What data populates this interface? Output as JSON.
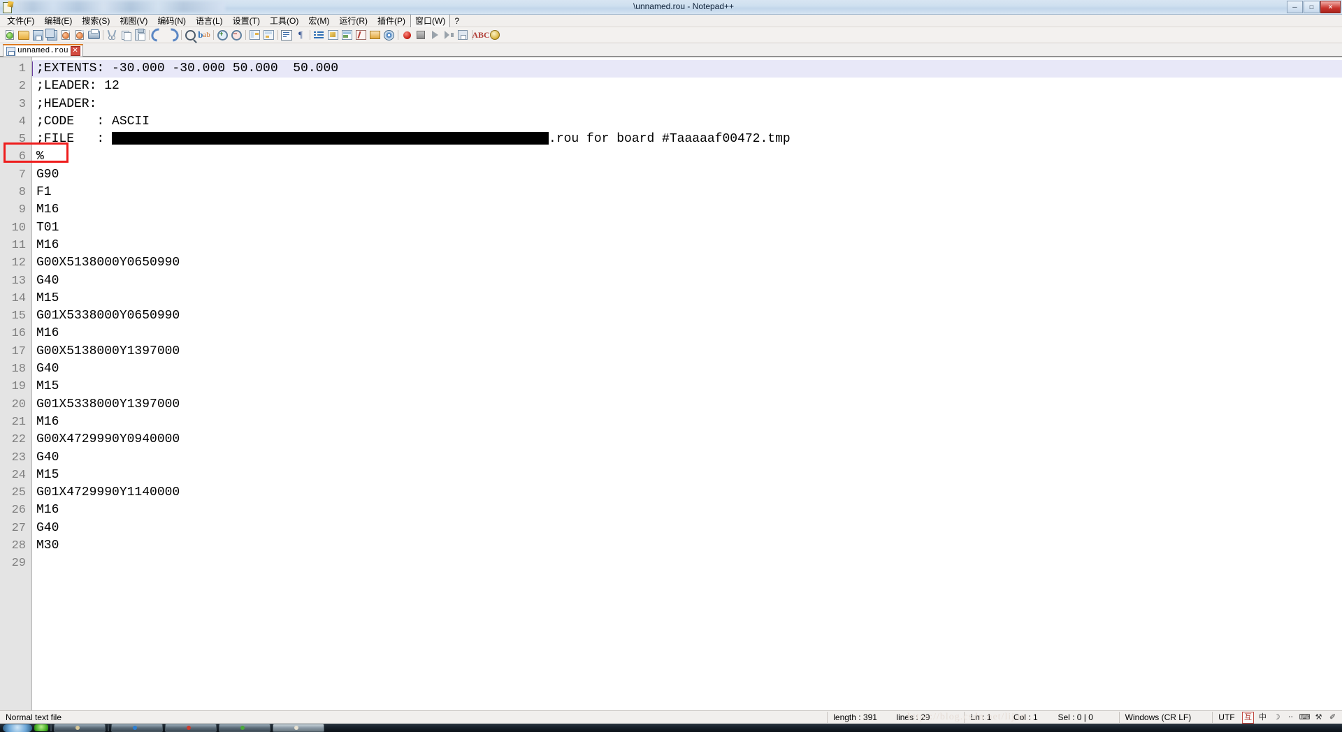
{
  "window": {
    "title": "\\unnamed.rou - Notepad++",
    "blurred_path_prefix": true,
    "buttons": {
      "minimize": "─",
      "maximize": "□",
      "close": "✕"
    }
  },
  "menubar": {
    "items": [
      {
        "label": "文件(F)",
        "boxed": false
      },
      {
        "label": "编辑(E)",
        "boxed": false
      },
      {
        "label": "搜索(S)",
        "boxed": false
      },
      {
        "label": "视图(V)",
        "boxed": false
      },
      {
        "label": "编码(N)",
        "boxed": false
      },
      {
        "label": "语言(L)",
        "boxed": false
      },
      {
        "label": "设置(T)",
        "boxed": false
      },
      {
        "label": "工具(O)",
        "boxed": false
      },
      {
        "label": "宏(M)",
        "boxed": false
      },
      {
        "label": "运行(R)",
        "boxed": false
      },
      {
        "label": "插件(P)",
        "boxed": false
      },
      {
        "label": "窗口(W)",
        "boxed": true
      },
      {
        "label": "?",
        "boxed": false
      }
    ]
  },
  "toolbar": {
    "icons": [
      "new-file-icon",
      "open-file-icon",
      "save-icon",
      "save-all-icon",
      "close-file-icon",
      "close-all-icon",
      "print-icon",
      "sep",
      "cut-icon",
      "copy-icon",
      "paste-icon",
      "sep",
      "undo-icon",
      "redo-icon",
      "sep",
      "find-icon",
      "replace-icon",
      "sep",
      "zoom-in-icon",
      "zoom-out-icon",
      "sep",
      "sync-vertical-icon",
      "sync-horizontal-icon",
      "sep",
      "word-wrap-icon",
      "show-all-chars-icon",
      "sep",
      "indent-guide-icon",
      "user-define-dialog-icon",
      "document-map-icon",
      "function-list-icon",
      "folder-as-workspace-icon",
      "monitoring-icon",
      "sep",
      "record-macro-icon",
      "stop-macro-icon",
      "playback-macro-icon",
      "run-macro-multiple-icon",
      "save-macro-icon",
      "sep",
      "spell-check-icon",
      "run-icon"
    ]
  },
  "tabs": [
    {
      "label": "unnamed.rou",
      "icon": "saved-file-icon",
      "close": "✕",
      "active": true
    }
  ],
  "editor": {
    "current_line": 1,
    "annotation_box_line": 6,
    "lines": [
      {
        "n": "1",
        "text": ";EXTENTS: -30.000 -30.000 50.000  50.000"
      },
      {
        "n": "2",
        "text": ";LEADER: 12"
      },
      {
        "n": "3",
        "text": ";HEADER:"
      },
      {
        "n": "4",
        "text": ";CODE   : ASCII"
      },
      {
        "n": "5",
        "text": ";FILE   : ",
        "redacted_width": 625,
        "text_after": ".rou for board #Taaaaaf00472.tmp"
      },
      {
        "n": "6",
        "text": "%"
      },
      {
        "n": "7",
        "text": "G90"
      },
      {
        "n": "8",
        "text": "F1"
      },
      {
        "n": "9",
        "text": "M16"
      },
      {
        "n": "10",
        "text": "T01"
      },
      {
        "n": "11",
        "text": "M16"
      },
      {
        "n": "12",
        "text": "G00X5138000Y0650990"
      },
      {
        "n": "13",
        "text": "G40"
      },
      {
        "n": "14",
        "text": "M15"
      },
      {
        "n": "15",
        "text": "G01X5338000Y0650990"
      },
      {
        "n": "16",
        "text": "M16"
      },
      {
        "n": "17",
        "text": "G00X5138000Y1397000"
      },
      {
        "n": "18",
        "text": "G40"
      },
      {
        "n": "19",
        "text": "M15"
      },
      {
        "n": "20",
        "text": "G01X5338000Y1397000"
      },
      {
        "n": "21",
        "text": "M16"
      },
      {
        "n": "22",
        "text": "G00X4729990Y0940000"
      },
      {
        "n": "23",
        "text": "G40"
      },
      {
        "n": "24",
        "text": "M15"
      },
      {
        "n": "25",
        "text": "G01X4729990Y1140000"
      },
      {
        "n": "26",
        "text": "M16"
      },
      {
        "n": "27",
        "text": "G40"
      },
      {
        "n": "28",
        "text": "M30"
      },
      {
        "n": "29",
        "text": ""
      }
    ]
  },
  "statusbar": {
    "filetype": "Normal text file",
    "length": "length : 391",
    "lines": "lines : 29",
    "ln": "Ln : 1",
    "col": "Col : 1",
    "sel": "Sel : 0 | 0",
    "eol": "Windows (CR LF)",
    "encoding": "UTF",
    "watermark": "https://blog.csdn.net/lijun...",
    "ime": {
      "mode_box": "互",
      "lang": "中",
      "punctuation": "☽",
      "half_full": "⋅⋅",
      "keyboard": "⌨",
      "tools": "⚒",
      "settings": "✐"
    }
  },
  "colors": {
    "accent_tab": "#e07b20",
    "annotation_red": "#ee1c1c",
    "current_line_bg": "#e8e8f8",
    "gutter_bg": "#e4e4e4",
    "redaction": "#000000"
  }
}
